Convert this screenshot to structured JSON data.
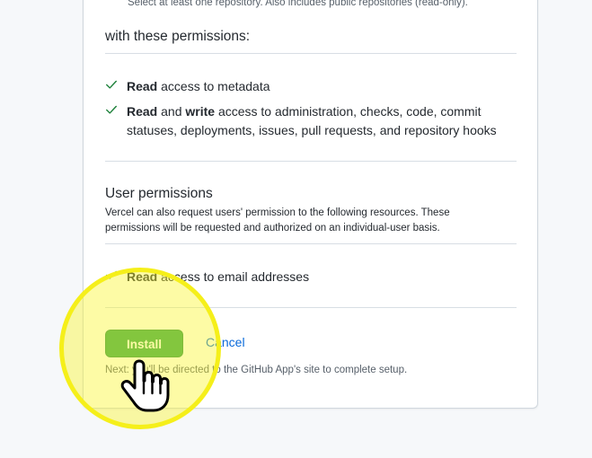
{
  "install_card": {
    "repository_note": "Select at least one repository. Also includes public repositories (read-only).",
    "permissions_heading": "with these permissions:",
    "repo_permissions": [
      {
        "bold_1": "Read",
        "text_1": " access to metadata",
        "bold_2": "",
        "text_2": ""
      },
      {
        "bold_1": "Read",
        "text_1": " and ",
        "bold_2": "write",
        "text_2": " access to administration, checks, code, commit statuses, deployments, issues, pull requests, and repository hooks"
      }
    ],
    "user_permissions": {
      "title": "User permissions",
      "description": "Vercel can also request users' permission to the following resources. These permissions will be requested and authorized on an individual-user basis.",
      "items": [
        {
          "bold": "Read",
          "text": " access to email addresses"
        }
      ]
    },
    "install_button": "Install",
    "cancel_link": "Cancel",
    "next_note": "Next: you'll be directed to the GitHub App's site to complete setup."
  },
  "colors": {
    "install_button": "#2da44e",
    "link": "#0969da",
    "check": "#1a7f37",
    "highlight": "#f5ef1a"
  },
  "icons": {
    "check": "check-icon",
    "cursor": "hand-pointer-icon"
  }
}
